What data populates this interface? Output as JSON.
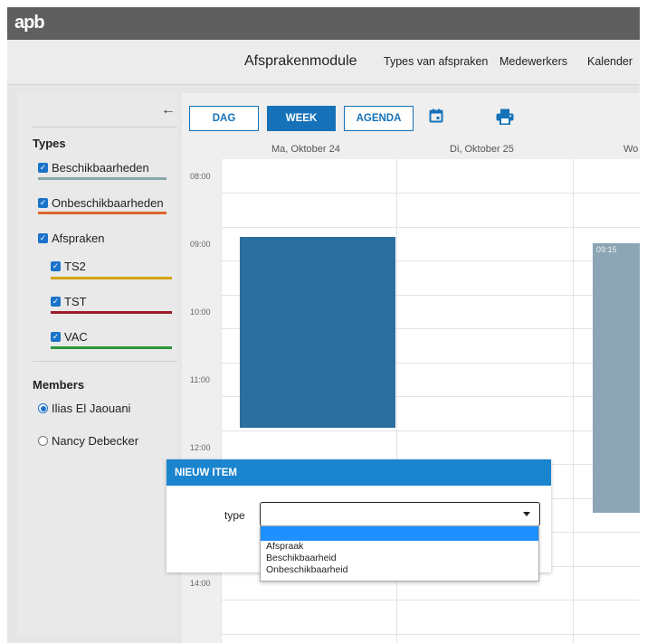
{
  "brand": {
    "logo_text": "apb"
  },
  "nav": {
    "title": "Afsprakenmodule",
    "links": [
      "Types van afspraken",
      "Medewerkers",
      "Kalender"
    ]
  },
  "sidebar": {
    "back_icon": "arrow-left-icon",
    "types_heading": "Types",
    "types": [
      {
        "label": "Beschikbaarheden",
        "checked": true,
        "color": "#8aa6ad"
      },
      {
        "label": "Onbeschikbaarheden",
        "checked": true,
        "color": "#d9662b"
      },
      {
        "label": "Afspraken",
        "checked": true
      }
    ],
    "sub_types": [
      {
        "label": "TS2",
        "checked": true,
        "color": "#d4a417"
      },
      {
        "label": "TST",
        "checked": true,
        "color": "#9e1b2a"
      },
      {
        "label": "VAC",
        "checked": true,
        "color": "#28963a"
      }
    ],
    "members_heading": "Members",
    "members": [
      {
        "label": "Ilias El Jaouani",
        "selected": true
      },
      {
        "label": "Nancy Debecker",
        "selected": false
      }
    ]
  },
  "calendar": {
    "views": [
      "DAG",
      "WEEK",
      "AGENDA"
    ],
    "active_view": "WEEK",
    "tool_icons": [
      "calendar-icon",
      "print-icon"
    ],
    "days": [
      "Ma, Oktober 24",
      "Di, Oktober 25",
      "Wo"
    ],
    "hours": [
      "08:00",
      "09:00",
      "10:00",
      "11:00",
      "12:00",
      "14:00"
    ],
    "event_day3_time": "09:15",
    "event_colors": {
      "primary": "#2a6f9e",
      "muted": "#8ba5b5"
    }
  },
  "modal": {
    "title": "NIEUW ITEM",
    "type_label": "type",
    "select_value": "",
    "options": [
      "",
      "Afspraak",
      "Beschikbaarheid",
      "Onbeschikbaarheid"
    ]
  }
}
